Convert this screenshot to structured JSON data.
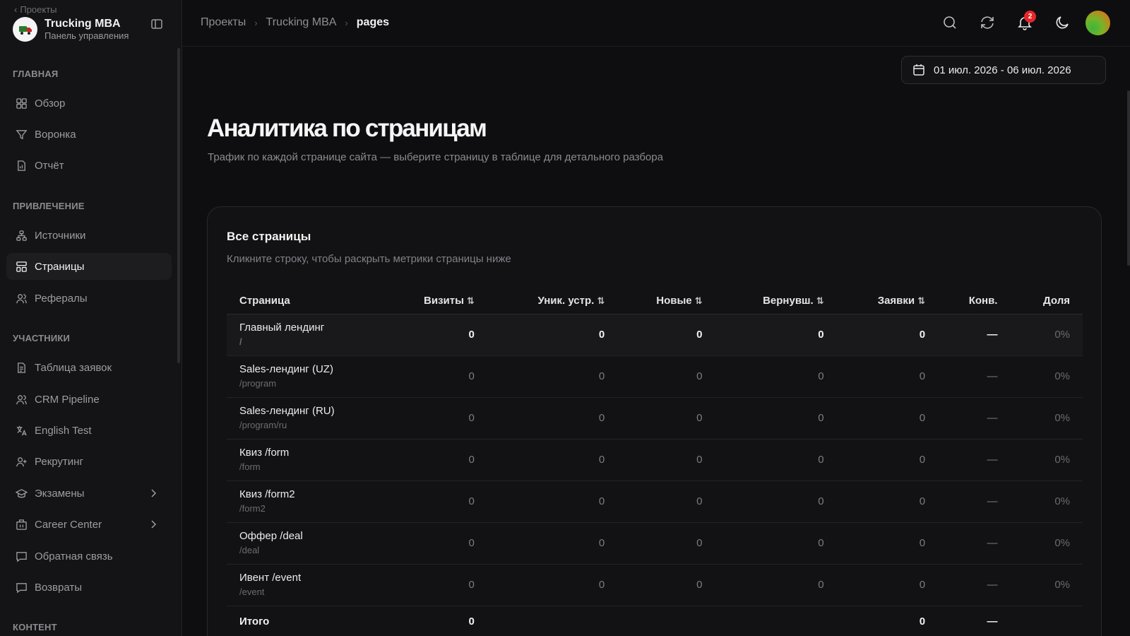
{
  "sidebar": {
    "back_label": "Проекты",
    "brand_title": "Trucking MBA",
    "brand_subtitle": "Панель управления",
    "sections": {
      "main": "ГЛАВНАЯ",
      "acquisition": "ПРИВЛЕЧЕНИЕ",
      "participants": "УЧАСТНИКИ",
      "content": "КОНТЕНТ"
    },
    "items": {
      "overview": "Обзор",
      "funnel": "Воронка",
      "report": "Отчёт",
      "sources": "Источники",
      "pages": "Страницы",
      "referrals": "Рефералы",
      "applications_table": "Таблица заявок",
      "crm_pipeline": "CRM Pipeline",
      "english_test": "English Test",
      "recruiting": "Рекрутинг",
      "exams": "Экзамены",
      "career_center": "Career Center",
      "feedback": "Обратная связь",
      "refunds": "Возвраты"
    },
    "active": "pages"
  },
  "topbar": {
    "breadcrumb": [
      "Проекты",
      "Trucking MBA",
      "pages"
    ],
    "notification_count": "2"
  },
  "date_range": "01 июл. 2026 - 06 июл. 2026",
  "page": {
    "title": "Аналитика по страницам",
    "description": "Трафик по каждой странице сайта — выберите страницу в таблице для детального разбора"
  },
  "card": {
    "title": "Все страницы",
    "subtitle": "Кликните строку, чтобы раскрыть метрики страницы ниже"
  },
  "table": {
    "columns": [
      "Страница",
      "Визиты",
      "Уник. устр.",
      "Новые",
      "Вернувш.",
      "Заявки",
      "Конв.",
      "Доля"
    ],
    "sort_icon": "⇅",
    "rows": [
      {
        "name": "Главный лендинг",
        "path": "/",
        "visits": "0",
        "unique": "0",
        "new": "0",
        "returning": "0",
        "leads": "0",
        "conv": "—",
        "share": "0%"
      },
      {
        "name": "Sales-лендинг (UZ)",
        "path": "/program",
        "visits": "0",
        "unique": "0",
        "new": "0",
        "returning": "0",
        "leads": "0",
        "conv": "—",
        "share": "0%"
      },
      {
        "name": "Sales-лендинг (RU)",
        "path": "/program/ru",
        "visits": "0",
        "unique": "0",
        "new": "0",
        "returning": "0",
        "leads": "0",
        "conv": "—",
        "share": "0%"
      },
      {
        "name": "Квиз /form",
        "path": "/form",
        "visits": "0",
        "unique": "0",
        "new": "0",
        "returning": "0",
        "leads": "0",
        "conv": "—",
        "share": "0%"
      },
      {
        "name": "Квиз /form2",
        "path": "/form2",
        "visits": "0",
        "unique": "0",
        "new": "0",
        "returning": "0",
        "leads": "0",
        "conv": "—",
        "share": "0%"
      },
      {
        "name": "Оффер /deal",
        "path": "/deal",
        "visits": "0",
        "unique": "0",
        "new": "0",
        "returning": "0",
        "leads": "0",
        "conv": "—",
        "share": "0%"
      },
      {
        "name": "Ивент /event",
        "path": "/event",
        "visits": "0",
        "unique": "0",
        "new": "0",
        "returning": "0",
        "leads": "0",
        "conv": "—",
        "share": "0%"
      }
    ],
    "total": {
      "label": "Итого",
      "visits": "0",
      "leads": "0",
      "conv": "—"
    }
  },
  "colors": {
    "background": "#0e0e10",
    "sidebar": "#141416",
    "badge": "#e5262a"
  }
}
